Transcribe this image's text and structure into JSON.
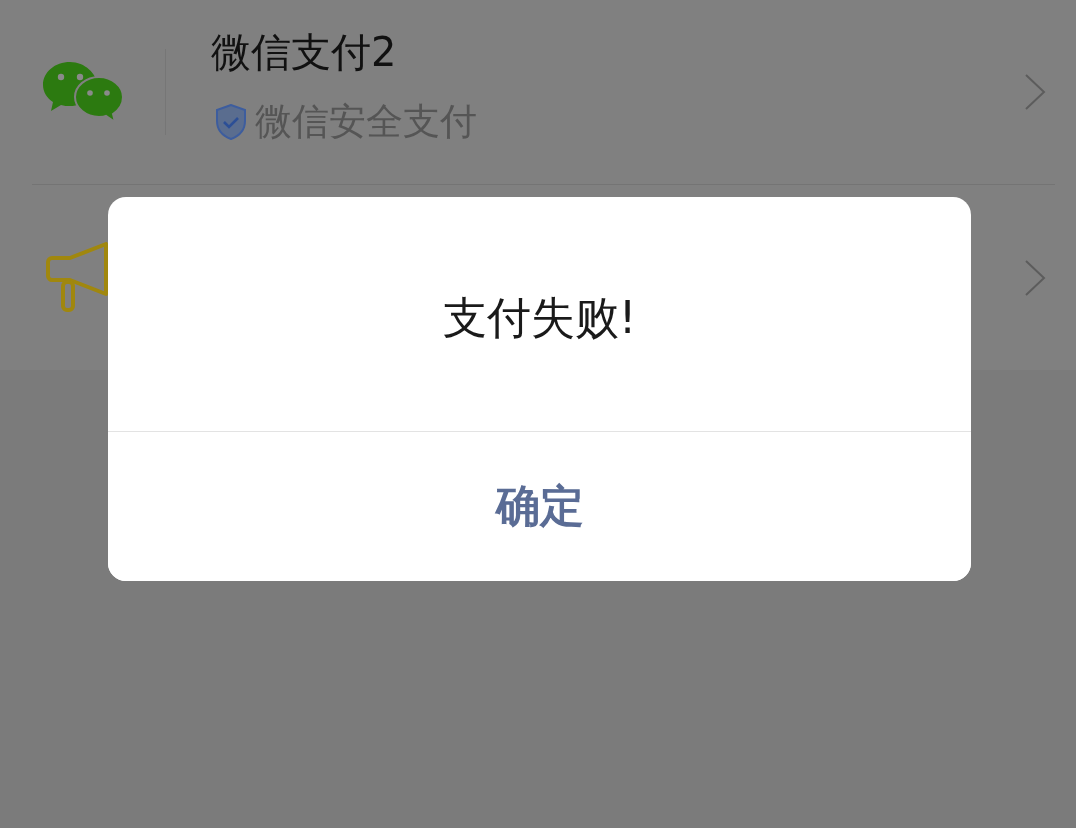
{
  "list": {
    "items": [
      {
        "kind": "wechat",
        "title": "微信支付2",
        "subtitle": "微信安全支付",
        "verified": true
      },
      {
        "kind": "megaphone"
      }
    ]
  },
  "dialog": {
    "message": "支付失败!",
    "button": "确定"
  }
}
